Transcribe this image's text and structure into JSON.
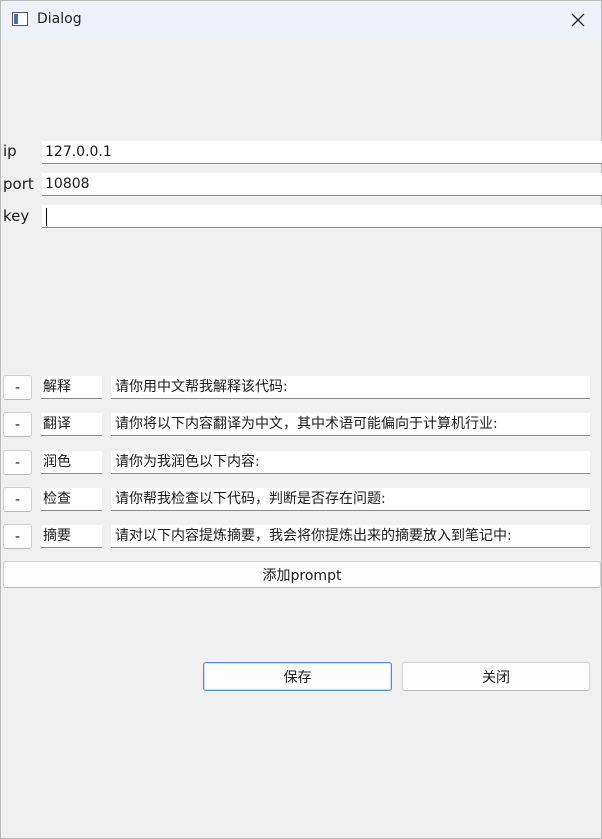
{
  "window": {
    "title": "Dialog",
    "icon": "app-window-icon",
    "close_icon": "close-icon"
  },
  "settings": {
    "ip_label": "ip",
    "ip_value": "127.0.0.1",
    "port_label": "port",
    "port_value": "10808",
    "key_label": "key",
    "key_value": ""
  },
  "prompts": [
    {
      "remove": "-",
      "name": "解释",
      "text": "请你用中文帮我解释该代码:"
    },
    {
      "remove": "-",
      "name": "翻译",
      "text": "请你将以下内容翻译为中文，其中术语可能偏向于计算机行业:"
    },
    {
      "remove": "-",
      "name": "润色",
      "text": "请你为我润色以下内容:"
    },
    {
      "remove": "-",
      "name": "检查",
      "text": "请你帮我检查以下代码，判断是否存在问题:"
    },
    {
      "remove": "-",
      "name": "摘要",
      "text": "请对以下内容提炼摘要，我会将你提炼出来的摘要放入到笔记中:"
    }
  ],
  "buttons": {
    "add_prompt": "添加prompt",
    "save": "保存",
    "close": "关闭"
  }
}
